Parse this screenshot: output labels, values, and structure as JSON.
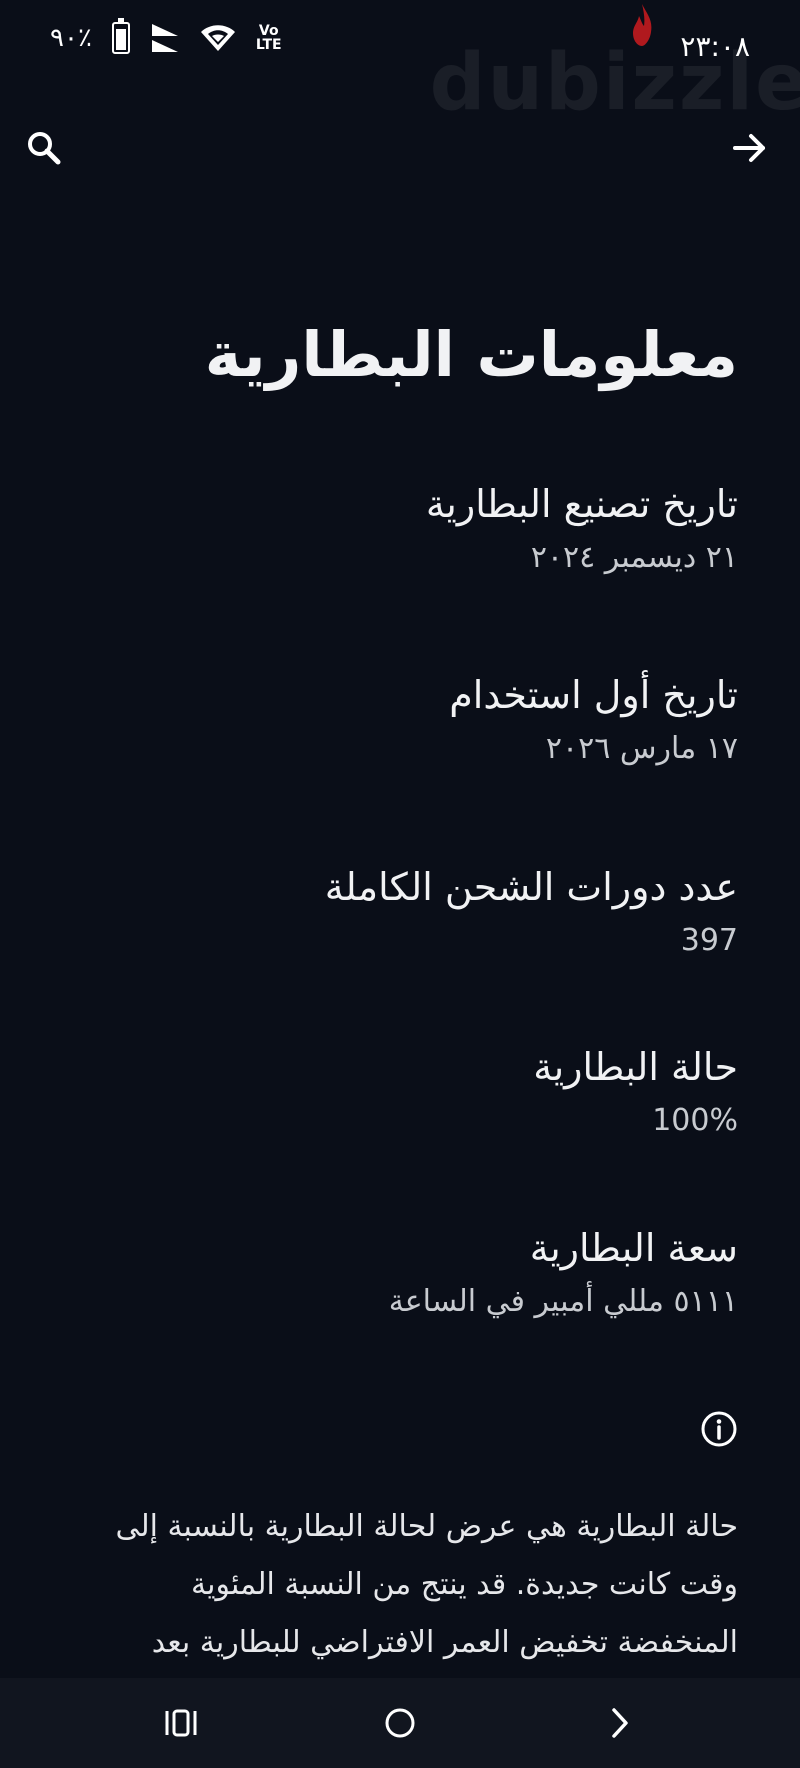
{
  "status_bar": {
    "battery_percent": "٪٩٠",
    "battery_level": 0.9,
    "volte_top": "Vo",
    "volte_bottom": "LTE",
    "time": "٢٣:٠٨",
    "watermark": "dubizzle"
  },
  "top_bar": {
    "search_icon": "search-icon",
    "back_icon": "arrow-right-icon"
  },
  "page_title": "معلومات البطارية",
  "items": [
    {
      "label": "تاريخ تصنيع البطارية",
      "value": "٢١ ديسمبر ٢٠٢٤"
    },
    {
      "label": "تاريخ أول استخدام",
      "value": "١٧ مارس ٢٠٢٦"
    },
    {
      "label": "عدد دورات الشحن الكاملة",
      "value": "397"
    },
    {
      "label": "حالة البطارية",
      "value": "100%"
    },
    {
      "label": "سعة البطارية",
      "value": "٥١١١ مللي أمبير في الساعة"
    }
  ],
  "info_icon": "info-icon",
  "description": "حالة البطارية هي عرض لحالة البطارية بالنسبة إلى وقت كانت جديدة. قد ينتج من النسبة المئوية المنخفضة تخفيض العمر الافتراضي للبطارية بعد الشحن.",
  "nav_bar": {
    "recents_icon": "recents-icon",
    "home_icon": "home-icon",
    "back_icon": "chevron-back-icon"
  }
}
